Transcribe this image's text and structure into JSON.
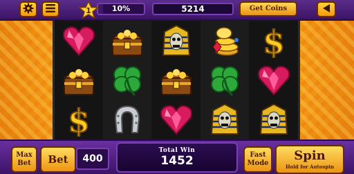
{
  "top_bar": {
    "settings_icon": "gear-icon",
    "menu_icon": "hamburger-menu-icon",
    "level": "1",
    "level_progress_text": "10%",
    "level_progress": 0.1,
    "coins": "5214",
    "get_coins_label": "Get Coins",
    "back_icon": "back-arrow-icon"
  },
  "reels": [
    [
      "ruby-heart",
      "treasure-chest",
      "dollar-sign"
    ],
    [
      "treasure-chest",
      "clover",
      "horseshoe"
    ],
    [
      "pharaoh-mask",
      "treasure-chest",
      "ruby-heart"
    ],
    [
      "gold-coins-gem",
      "clover",
      "pharaoh-mask"
    ],
    [
      "dollar-sign",
      "ruby-heart",
      "pharaoh-mask"
    ]
  ],
  "bottom_bar": {
    "max_bet_label": "Max Bet",
    "bet_label": "Bet",
    "bet_value": "400",
    "total_win_label": "Total Win",
    "total_win_value": "1452",
    "fast_mode_label": "Fast Mode",
    "spin_label": "Spin",
    "spin_sublabel": "Hold for Autospin"
  },
  "colors": {
    "background": "#f3a21a",
    "bar_purple": "#3b1466",
    "button_gold": "#ffd23a",
    "reel_dark": "#141414"
  }
}
